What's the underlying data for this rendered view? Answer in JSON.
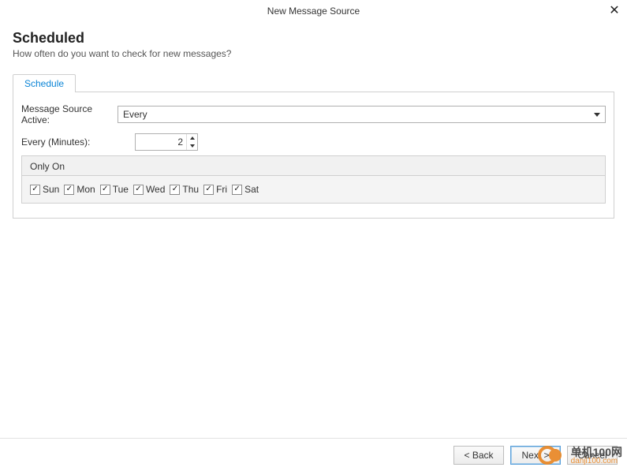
{
  "window": {
    "title": "New Message Source"
  },
  "header": {
    "title": "Scheduled",
    "subtitle": "How often do you want to check for new messages?"
  },
  "tabs": [
    {
      "label": "Schedule"
    }
  ],
  "form": {
    "active_label": "Message Source Active:",
    "active_value": "Every",
    "interval_label": "Every (Minutes):",
    "interval_value": "2"
  },
  "only_on": {
    "title": "Only On",
    "days": [
      {
        "label": "Sun",
        "checked": true
      },
      {
        "label": "Mon",
        "checked": true
      },
      {
        "label": "Tue",
        "checked": true
      },
      {
        "label": "Wed",
        "checked": true
      },
      {
        "label": "Thu",
        "checked": true
      },
      {
        "label": "Fri",
        "checked": true
      },
      {
        "label": "Sat",
        "checked": true
      }
    ]
  },
  "footer": {
    "back": "< Back",
    "next": "Next >",
    "cancel": "Cancel"
  },
  "watermark": {
    "line1": "单机100网",
    "line2": "danji100.com"
  }
}
